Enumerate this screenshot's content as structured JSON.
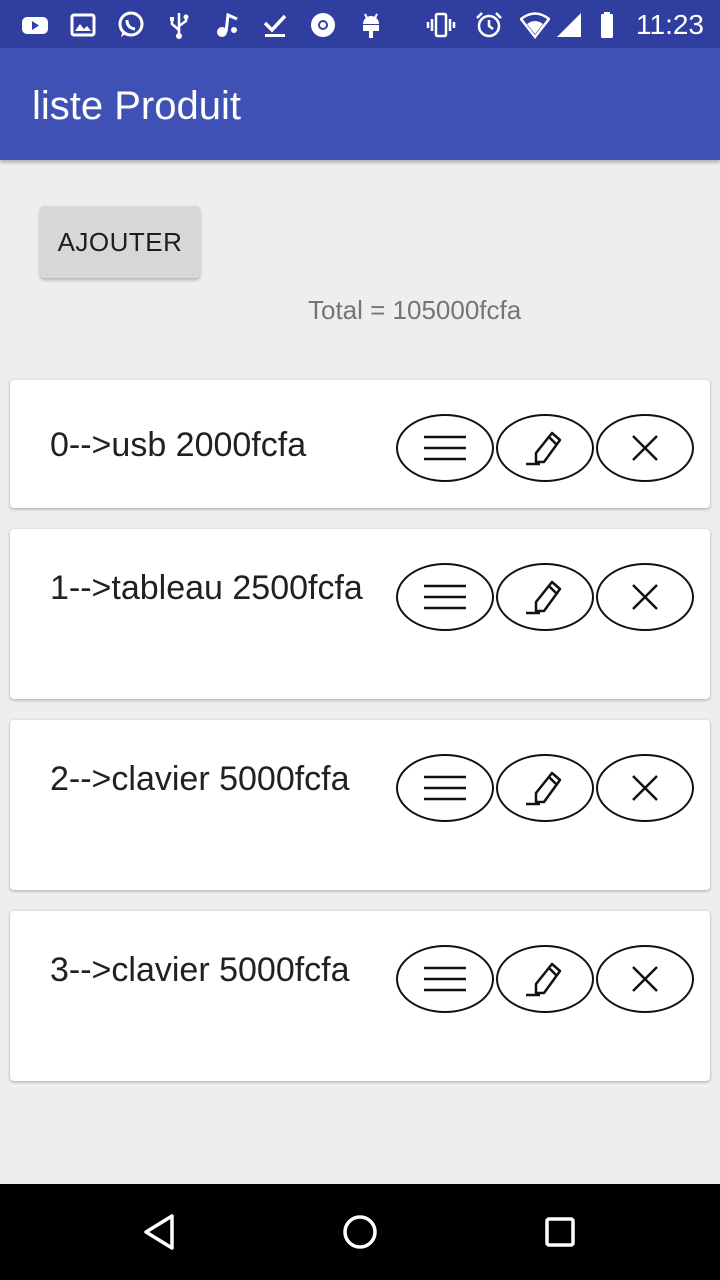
{
  "status_bar": {
    "time": "11:23",
    "icons": [
      "youtube-icon",
      "image-icon",
      "whatsapp-icon",
      "usb-icon",
      "music-icon",
      "download-done-icon",
      "chrome-icon",
      "android-icon",
      "vibrate-icon",
      "alarm-icon",
      "wifi-icon",
      "signal-icon",
      "battery-icon"
    ]
  },
  "app_bar": {
    "title": "liste Produit"
  },
  "actions": {
    "add_label": "AJOUTER"
  },
  "summary": {
    "total": "Total = 105000fcfa"
  },
  "products": [
    {
      "label": "0-->usb 2000fcfa"
    },
    {
      "label": "1-->tableau 2500fcfa"
    },
    {
      "label": "2-->clavier 5000fcfa"
    },
    {
      "label": "3-->clavier 5000fcfa"
    }
  ],
  "row_actions": [
    "menu-icon",
    "edit-icon",
    "close-icon"
  ],
  "nav_bar": {
    "buttons": [
      "back-icon",
      "home-icon",
      "recents-icon"
    ]
  },
  "colors": {
    "status_bar": "#303f9f",
    "app_bar": "#3f51b5",
    "background": "#eeeeee",
    "button": "#d6d7d7"
  }
}
